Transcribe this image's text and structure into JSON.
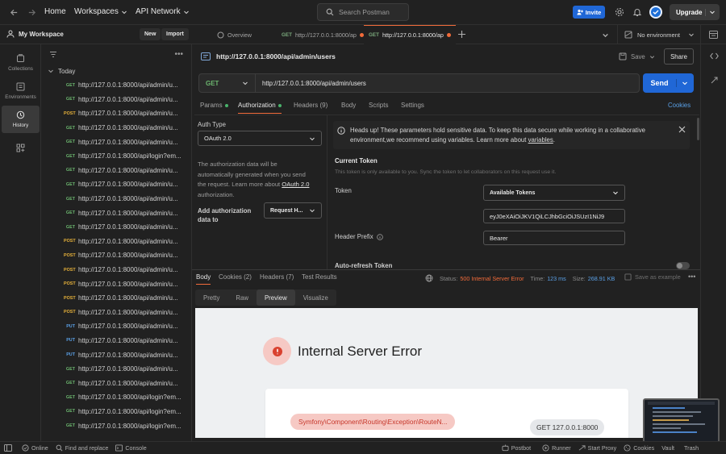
{
  "topbar": {
    "home": "Home",
    "workspaces": "Workspaces",
    "api_network": "API Network",
    "search_placeholder": "Search Postman",
    "invite": "Invite",
    "upgrade": "Upgrade"
  },
  "workspace": {
    "name": "My Workspace",
    "new_label": "New",
    "import_label": "Import"
  },
  "tabs": [
    {
      "label": "Overview"
    },
    {
      "method": "GET",
      "label": "http://127.0.0.1:8000/ap"
    },
    {
      "method": "GET",
      "label": "http://127.0.0.1:8000/ap"
    }
  ],
  "environment": "No environment",
  "rail": [
    {
      "label": "Collections"
    },
    {
      "label": "Environments"
    },
    {
      "label": "History"
    }
  ],
  "history": {
    "group": "Today",
    "items": [
      {
        "method": "GET",
        "url": "http://127.0.0.1:8000/api/admin/u..."
      },
      {
        "method": "GET",
        "url": "http://127.0.0.1:8000/api/admin/u..."
      },
      {
        "method": "POST",
        "url": "http://127.0.0.1:8000/api/admin/u..."
      },
      {
        "method": "GET",
        "url": "http://127.0.0.1:8000/api/admin/u..."
      },
      {
        "method": "GET",
        "url": "http://127.0.0.1:8000/api/admin/u..."
      },
      {
        "method": "GET",
        "url": "http://127.0.0.1:8000/api/login?em..."
      },
      {
        "method": "GET",
        "url": "http://127.0.0.1:8000/api/admin/u..."
      },
      {
        "method": "GET",
        "url": "http://127.0.0.1:8000/api/admin/u..."
      },
      {
        "method": "GET",
        "url": "http://127.0.0.1:8000/api/admin/u..."
      },
      {
        "method": "GET",
        "url": "http://127.0.0.1:8000/api/admin/u..."
      },
      {
        "method": "GET",
        "url": "http://127.0.0.1:8000/api/admin/u..."
      },
      {
        "method": "POST",
        "url": "http://127.0.0.1:8000/api/admin/u..."
      },
      {
        "method": "POST",
        "url": "http://127.0.0.1:8000/api/admin/u..."
      },
      {
        "method": "POST",
        "url": "http://127.0.0.1:8000/api/admin/u..."
      },
      {
        "method": "POST",
        "url": "http://127.0.0.1:8000/api/admin/u..."
      },
      {
        "method": "POST",
        "url": "http://127.0.0.1:8000/api/admin/u..."
      },
      {
        "method": "POST",
        "url": "http://127.0.0.1:8000/api/admin/u..."
      },
      {
        "method": "PUT",
        "url": "http://127.0.0.1:8000/api/admin/u..."
      },
      {
        "method": "PUT",
        "url": "http://127.0.0.1:8000/api/admin/u..."
      },
      {
        "method": "PUT",
        "url": "http://127.0.0.1:8000/api/admin/u..."
      },
      {
        "method": "GET",
        "url": "http://127.0.0.1:8000/api/admin/u..."
      },
      {
        "method": "GET",
        "url": "http://127.0.0.1:8000/api/admin/u..."
      },
      {
        "method": "GET",
        "url": "http://127.0.0.1:8000/api/login?em..."
      },
      {
        "method": "GET",
        "url": "http://127.0.0.1:8000/api/login?em..."
      },
      {
        "method": "GET",
        "url": "http://127.0.0.1:8000/api/login?em..."
      }
    ]
  },
  "request": {
    "title": "http://127.0.0.1:8000/api/admin/users",
    "save": "Save",
    "share": "Share",
    "method": "GET",
    "url": "http://127.0.0.1:8000/api/admin/users",
    "send": "Send",
    "tabs": [
      "Params",
      "Authorization",
      "Headers (9)",
      "Body",
      "Scripts",
      "Settings"
    ],
    "cookies": "Cookies"
  },
  "auth": {
    "type_label": "Auth Type",
    "type_value": "OAuth 2.0",
    "desc_1": "The authorization data will be",
    "desc_2": "automatically generated when you send",
    "desc_3a": "the request. Learn more about ",
    "desc_link": "OAuth 2.0",
    "desc_4": "authorization.",
    "add_label_1": "Add authorization",
    "add_label_2": "data to",
    "add_value": "Request H...",
    "notice_1": "Heads up! These parameters hold sensitive data. To keep this data secure while working in a collaborative",
    "notice_2a": "environment,we recommend using variables. Learn more about ",
    "notice_link": "variables",
    "notice_2b": ".",
    "current_token": "Current Token",
    "token_note": "This token is only available to you. Sync the token to let collaborators on this request use it.",
    "token_label": "Token",
    "available_tokens": "Available Tokens",
    "token_value": "eyJ0eXAiOiJKV1QiLCJhbGciOiJSUzI1NiJ9",
    "header_prefix_label": "Header Prefix",
    "header_prefix_value": "Bearer",
    "auto_refresh": "Auto-refresh Token"
  },
  "response": {
    "tabs": [
      "Body",
      "Cookies (2)",
      "Headers (7)",
      "Test Results"
    ],
    "status_label": "Status:",
    "status_value": "500 Internal Server Error",
    "time_label": "Time:",
    "time_value": "123 ms",
    "size_label": "Size:",
    "size_value": "268.91 KB",
    "save_example": "Save as example",
    "view_tabs": [
      "Pretty",
      "Raw",
      "Preview",
      "Visualize"
    ],
    "error_title": "Internal Server Error",
    "exception": "Symfony\\Component\\Routing\\Exception\\RouteN...",
    "request_line": "GET 127.0.0.1:8000"
  },
  "statusbar": {
    "online": "Online",
    "find_replace": "Find and replace",
    "console": "Console",
    "postbot": "Postbot",
    "runner": "Runner",
    "start_proxy": "Start Proxy",
    "cookies": "Cookies",
    "vault": "Vault",
    "trash": "Trash"
  },
  "colors": {
    "accent": "#2067d6",
    "orange": "#f26b3a",
    "get": "#6bb56e",
    "post": "#e6b13a",
    "put": "#5aa0e6",
    "error": "#f26b3a"
  }
}
